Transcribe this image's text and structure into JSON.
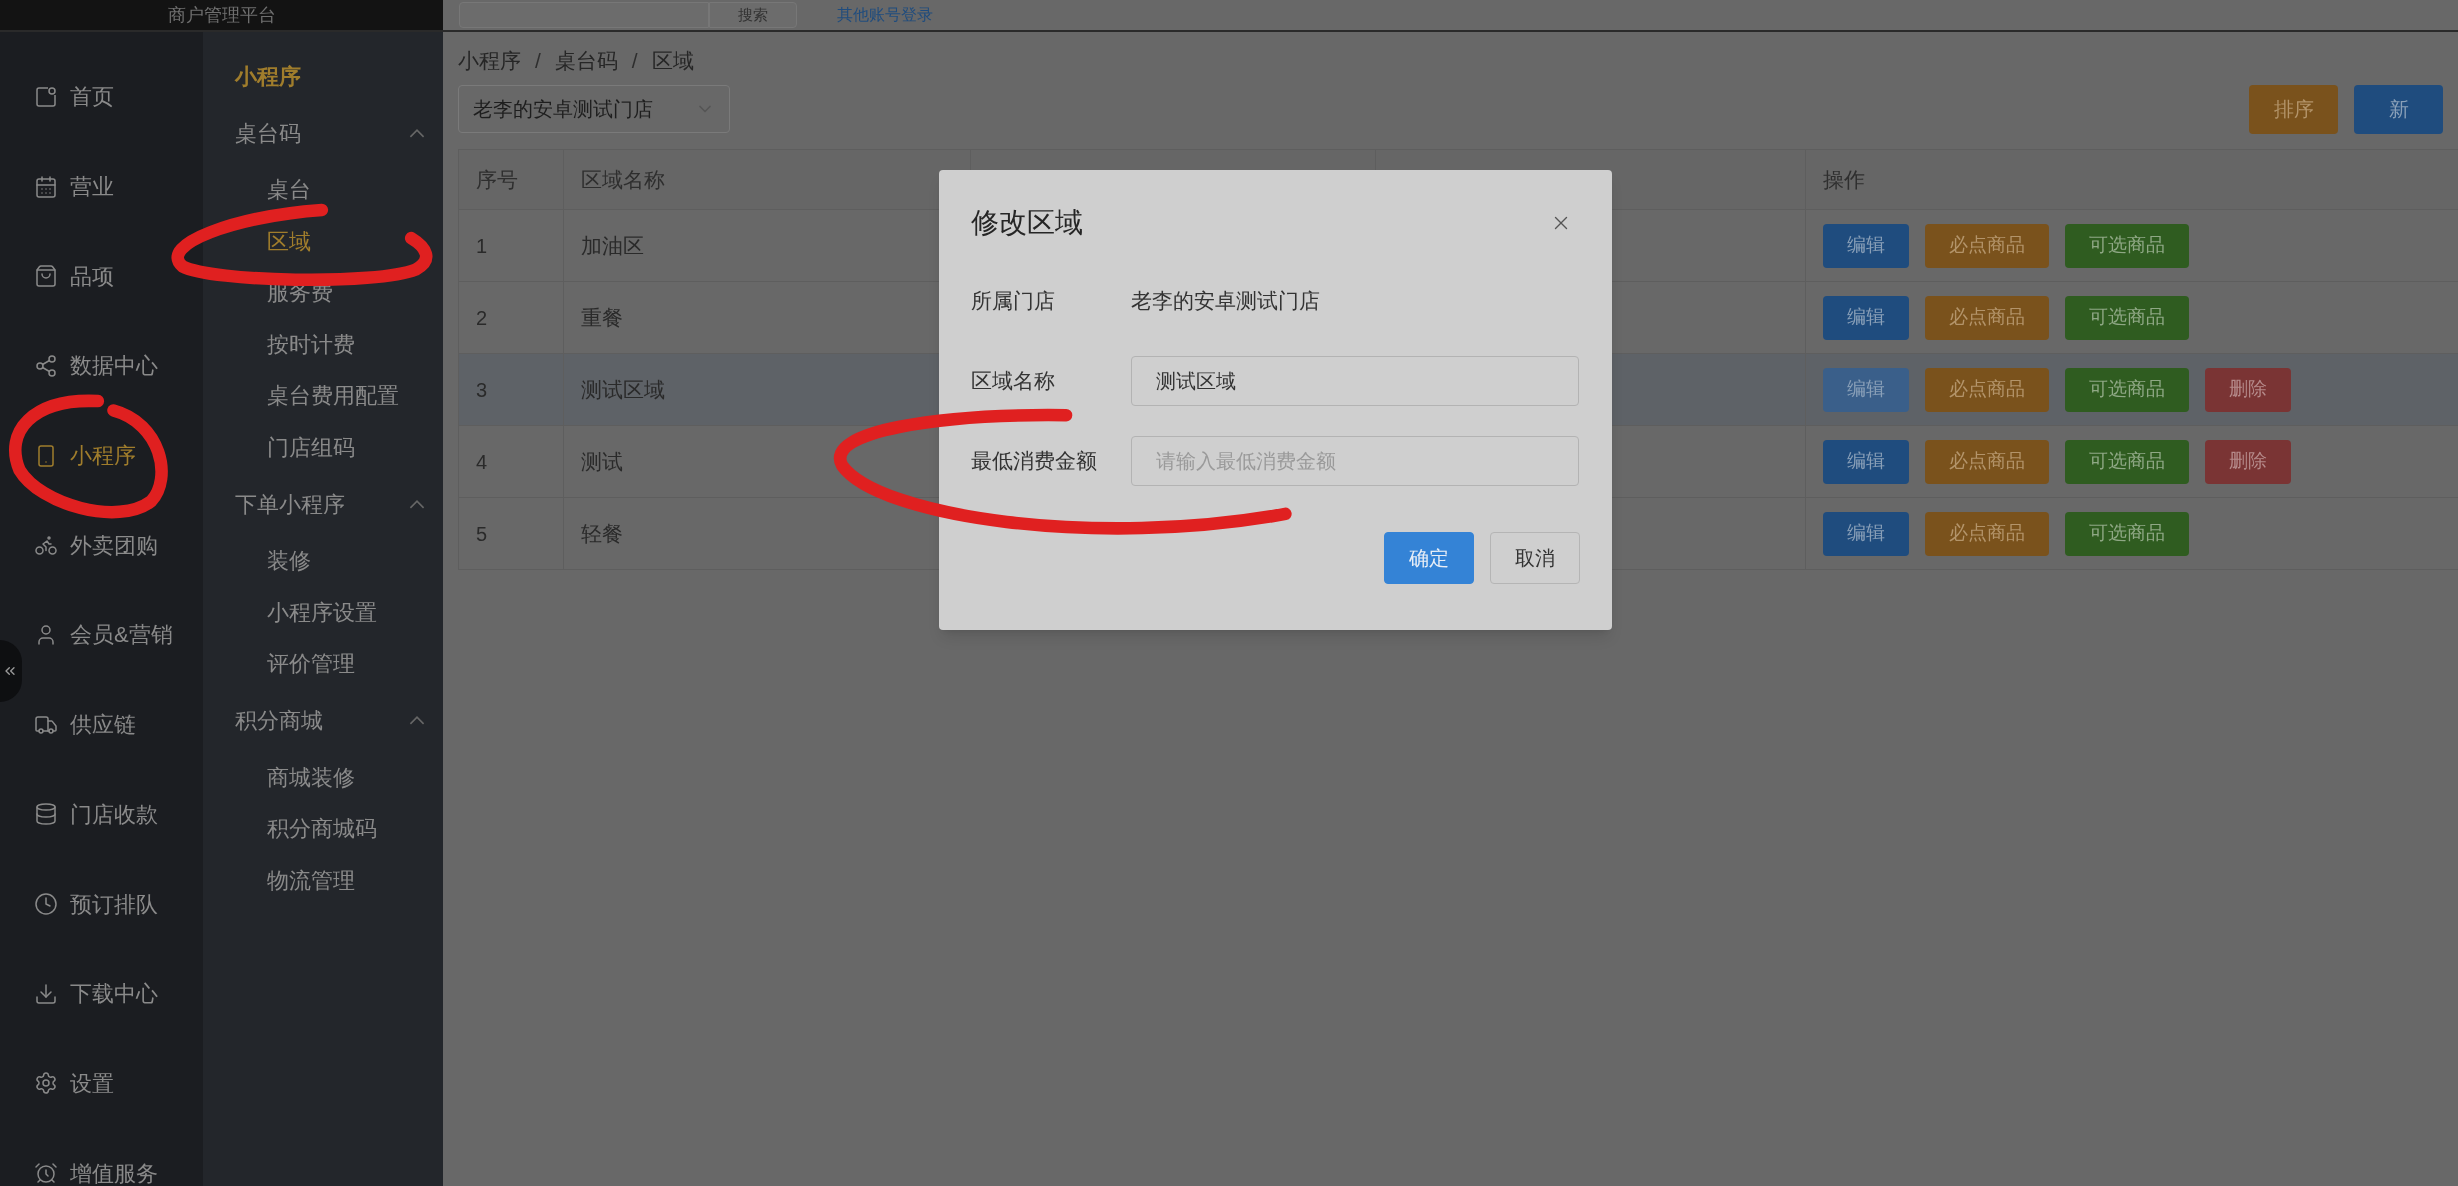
{
  "top_bar": {
    "title": "商户管理平台",
    "search_button": "搜索",
    "link": "其他账号登录"
  },
  "nav": {
    "items": [
      {
        "label": "首页",
        "selected": false
      },
      {
        "label": "营业",
        "selected": false
      },
      {
        "label": "品项",
        "selected": false
      },
      {
        "label": "数据中心",
        "selected": false
      },
      {
        "label": "小程序",
        "selected": true
      },
      {
        "label": "外卖团购",
        "selected": false
      },
      {
        "label": "会员&营销",
        "selected": false
      },
      {
        "label": "供应链",
        "selected": false
      },
      {
        "label": "门店收款",
        "selected": false
      },
      {
        "label": "预订排队",
        "selected": false
      },
      {
        "label": "下载中心",
        "selected": false
      },
      {
        "label": "设置",
        "selected": false
      },
      {
        "label": "增值服务",
        "selected": false
      }
    ]
  },
  "subnav": {
    "title": "小程序",
    "groups": [
      {
        "label": "桌台码",
        "expanded": true,
        "children": [
          {
            "label": "桌台",
            "selected": false
          },
          {
            "label": "区域",
            "selected": true
          },
          {
            "label": "服务费",
            "selected": false
          },
          {
            "label": "按时计费",
            "selected": false
          },
          {
            "label": "桌台费用配置",
            "selected": false
          },
          {
            "label": "门店组码",
            "selected": false
          }
        ]
      },
      {
        "label": "下单小程序",
        "expanded": true,
        "children": [
          {
            "label": "装修",
            "selected": false
          },
          {
            "label": "小程序设置",
            "selected": false
          },
          {
            "label": "评价管理",
            "selected": false
          }
        ]
      },
      {
        "label": "积分商城",
        "expanded": true,
        "children": [
          {
            "label": "商城装修",
            "selected": false
          },
          {
            "label": "积分商城码",
            "selected": false
          },
          {
            "label": "物流管理",
            "selected": false
          }
        ]
      }
    ]
  },
  "breadcrumb": {
    "items": [
      "小程序",
      "桌台码",
      "区域"
    ],
    "separator": "/"
  },
  "store_select": {
    "value": "老李的安卓测试门店"
  },
  "toolbar_buttons": [
    {
      "label": "排序",
      "kind": "warning"
    },
    {
      "label": "新",
      "kind": "primary"
    }
  ],
  "table": {
    "columns": [
      "序号",
      "区域名称",
      "操作"
    ],
    "rows": [
      {
        "index": "1",
        "name": "加油区",
        "highlighted": false,
        "actions": [
          {
            "label": "编辑",
            "kind": "primary"
          },
          {
            "label": "必点商品",
            "kind": "warning"
          },
          {
            "label": "可选商品",
            "kind": "success"
          }
        ]
      },
      {
        "index": "2",
        "name": "重餐",
        "highlighted": false,
        "actions": [
          {
            "label": "编辑",
            "kind": "primary"
          },
          {
            "label": "必点商品",
            "kind": "warning"
          },
          {
            "label": "可选商品",
            "kind": "success"
          }
        ]
      },
      {
        "index": "3",
        "name": "测试区域",
        "highlighted": true,
        "actions": [
          {
            "label": "编辑",
            "kind": "primary"
          },
          {
            "label": "必点商品",
            "kind": "warning"
          },
          {
            "label": "可选商品",
            "kind": "success"
          },
          {
            "label": "删除",
            "kind": "danger"
          }
        ]
      },
      {
        "index": "4",
        "name": "测试",
        "highlighted": false,
        "actions": [
          {
            "label": "编辑",
            "kind": "primary"
          },
          {
            "label": "必点商品",
            "kind": "warning"
          },
          {
            "label": "可选商品",
            "kind": "success"
          },
          {
            "label": "删除",
            "kind": "danger"
          }
        ]
      },
      {
        "index": "5",
        "name": "轻餐",
        "highlighted": false,
        "actions": [
          {
            "label": "编辑",
            "kind": "primary"
          },
          {
            "label": "必点商品",
            "kind": "warning"
          },
          {
            "label": "可选商品",
            "kind": "success"
          }
        ]
      }
    ]
  },
  "modal": {
    "title": "修改区域",
    "fields": [
      {
        "label": "所属门店",
        "kind": "text",
        "value": "老李的安卓测试门店"
      },
      {
        "label": "区域名称",
        "kind": "input",
        "value": "测试区域"
      },
      {
        "label": "最低消费金额",
        "kind": "input",
        "placeholder": "请输入最低消费金额"
      }
    ],
    "buttons": [
      {
        "label": "确定",
        "kind": "primary"
      },
      {
        "label": "取消",
        "kind": "default"
      }
    ]
  }
}
